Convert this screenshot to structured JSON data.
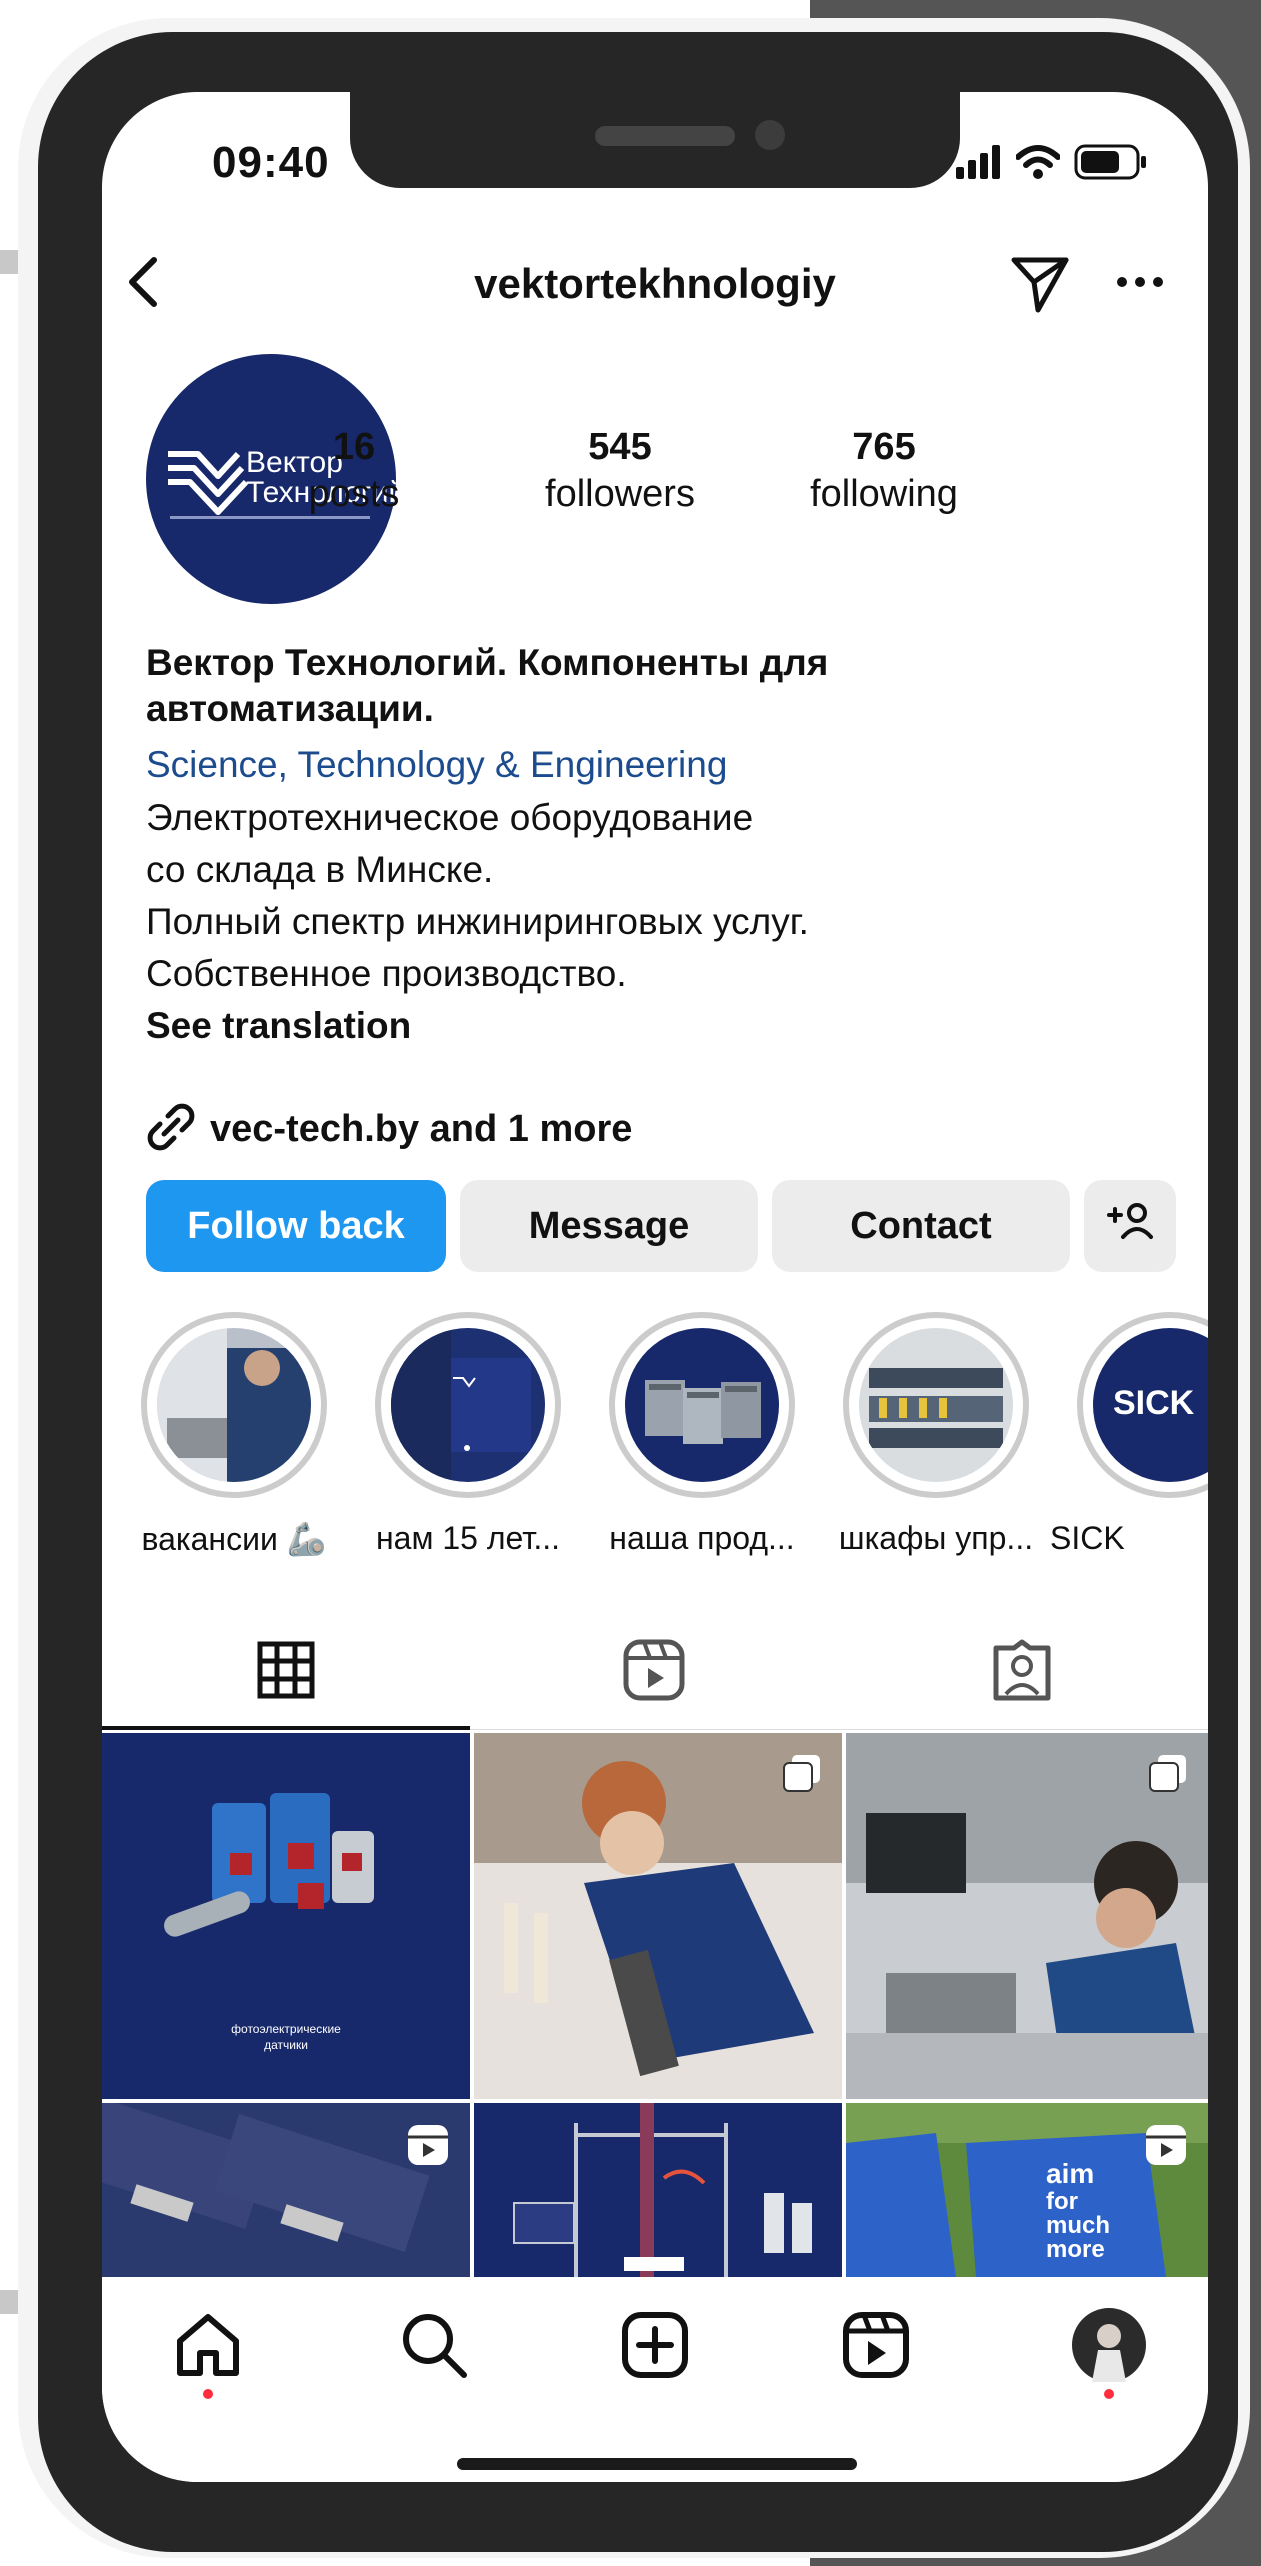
{
  "status_bar": {
    "time": "09:40"
  },
  "header": {
    "username": "vektortekhnologiy"
  },
  "avatar": {
    "brand_line1": "Вектор",
    "brand_line2": "Технологий"
  },
  "stats": [
    {
      "value": "16",
      "label": "posts"
    },
    {
      "value": "545",
      "label": "followers"
    },
    {
      "value": "765",
      "label": "following"
    }
  ],
  "bio": {
    "name_line1": "Вектор Технологий. Компоненты для",
    "name_line2": "автоматизации.",
    "category": "Science, Technology & Engineering",
    "lines": [
      "Электротехническое оборудование",
      "со склада в Минске.",
      "Полный спектр инжиниринговых услуг.",
      "Собственное производство."
    ],
    "see_translation": "See translation",
    "link": "vec-tech.by and 1 more"
  },
  "buttons": {
    "follow_back": "Follow back",
    "message": "Message",
    "contact": "Contact",
    "add_user": "+"
  },
  "highlights": [
    {
      "label": "вакансии 🦾"
    },
    {
      "label": "нам 15 лет..."
    },
    {
      "label": "наша прод..."
    },
    {
      "label": "шкафы упр..."
    },
    {
      "label": "SICK",
      "logo_text": "SICK"
    }
  ],
  "grid": {
    "post1_caption_line1": "фотоэлектрические",
    "post1_caption_line2": "датчики",
    "post6_text": [
      "aim",
      "for",
      "much",
      "more"
    ]
  },
  "colors": {
    "accent_blue": "#1d97f0",
    "brand_navy": "#17296b",
    "category_link": "#1c4c8e",
    "notification_dot": "#ff2d3d"
  }
}
